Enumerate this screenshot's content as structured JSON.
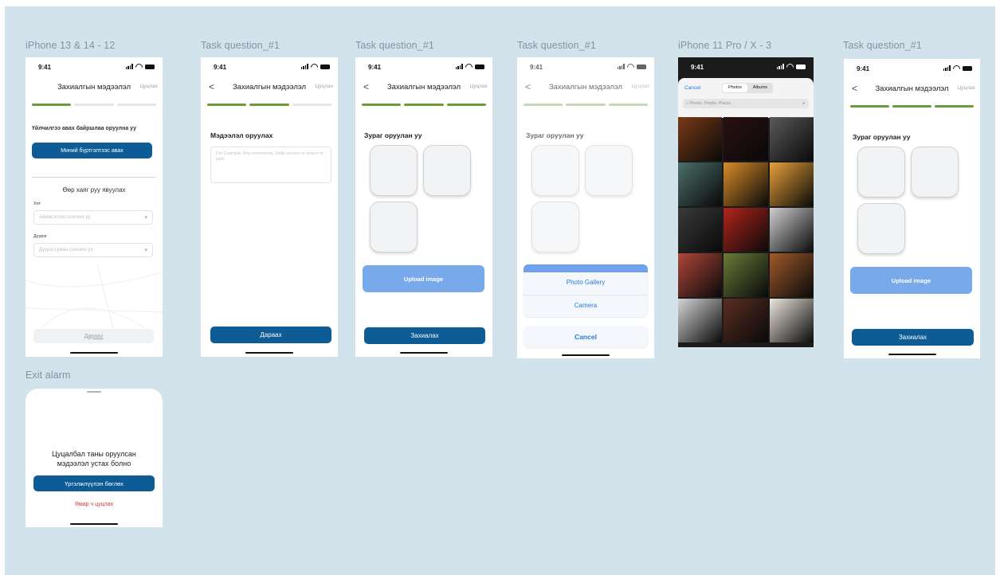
{
  "frame_titles": [
    "iPhone 13 & 14 - 12",
    "Task question_#1",
    "Task question_#1",
    "Task question_#1",
    "iPhone 11 Pro / X - 3",
    "Task question_#1",
    "Exit alarm"
  ],
  "status": {
    "time": "9:41"
  },
  "header": {
    "title": "Захиалгын мэдээлэл",
    "cancel": "Цуцлах",
    "back": "<"
  },
  "screen1": {
    "question": "Үйлчилгээ авах байршлаа оруулна уу",
    "my_account_button": "Миний бүртгэлтээс авах",
    "other_address": "Өөр хаяг руу явуулах",
    "city_label": "Хот",
    "city_placeholder": "Аймаг,хотоо сонгоно уу",
    "district_label": "Дүүрэг",
    "district_placeholder": "Дүүрэг,сумаа сонгоно уу",
    "next_button": "Дараах"
  },
  "screen2": {
    "label": "Мэдээлэл оруулах",
    "placeholder": "For Example: Any restrictions, Daily access or where to park",
    "next_button": "Дараах"
  },
  "screen3": {
    "label": "Зураг оруулан уу",
    "upload": "Upload image",
    "order_button": "Захиалах"
  },
  "screen4": {
    "label": "Зураг оруулан уу",
    "gallery": "Photo Gallery",
    "camera": "Camera",
    "cancel": "Cancel"
  },
  "screen5": {
    "cancel": "Cancel",
    "tab_photos": "Photos",
    "tab_albums": "Albums",
    "search_placeholder": "Photos, People, Places...",
    "photo_colors": [
      "#7a3a17",
      "#2a1010",
      "#5a5a5a",
      "#4c6f6a",
      "#d88c2a",
      "#e8a03a",
      "#3a3a3a",
      "#b2251c",
      "#cfcfcf",
      "#b0463a",
      "#6b7a3a",
      "#a05a2a",
      "#d5d5d5",
      "#5a2e22",
      "#ece6dc"
    ]
  },
  "screen6": {
    "label": "Зураг оруулан уу",
    "upload": "Upload image",
    "order_button": "Захиалах"
  },
  "exit_alarm": {
    "message_line1": "Цуцалбал таны оруулсан",
    "message_line2": "мэдээлэл устах болно",
    "continue_button": "Үргэлжлүүлэн бөглөх",
    "cancel_link": "Ямар ч цуцлах"
  },
  "colors": {
    "primary": "#0d5c96",
    "progress": "#6b9c3c",
    "upload": "#78a9ea",
    "canvas": "#d3e3ec",
    "danger": "#d33a2f"
  }
}
